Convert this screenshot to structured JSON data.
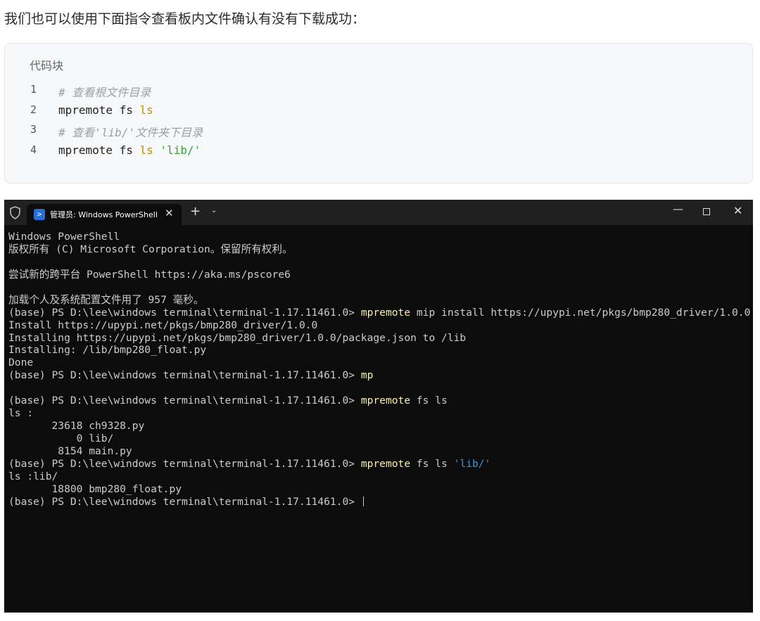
{
  "intro": "我们也可以使用下面指令查看板内文件确认有没有下载成功：",
  "code_block": {
    "title": "代码块",
    "lines": [
      {
        "n": "1",
        "comment": "# 查看根文件目录"
      },
      {
        "n": "2",
        "cmd": "mpremote fs ",
        "kw": "ls"
      },
      {
        "n": "3",
        "comment": "# 查看'lib/'文件夹下目录"
      },
      {
        "n": "4",
        "cmd": "mpremote fs ",
        "kw": "ls",
        "str": "'lib/'"
      }
    ]
  },
  "terminal": {
    "tab_title": "管理员: Windows PowerShell",
    "lines": [
      {
        "t": "Windows PowerShell"
      },
      {
        "t": "版权所有 (C) Microsoft Corporation。保留所有权利。"
      },
      {
        "t": ""
      },
      {
        "t": "尝试新的跨平台 PowerShell https://aka.ms/pscore6"
      },
      {
        "t": ""
      },
      {
        "t": "加载个人及系统配置文件用了 957 毫秒。"
      },
      {
        "t": "(base) PS D:\\lee\\windows terminal\\terminal-1.17.11461.0> ",
        "y": "mpremote",
        "r": " mip install https://upypi.net/pkgs/bmp280_driver/1.0.0"
      },
      {
        "t": "Install https://upypi.net/pkgs/bmp280_driver/1.0.0"
      },
      {
        "t": "Installing https://upypi.net/pkgs/bmp280_driver/1.0.0/package.json to /lib"
      },
      {
        "t": "Installing: /lib/bmp280_float.py"
      },
      {
        "t": "Done"
      },
      {
        "t": "(base) PS D:\\lee\\windows terminal\\terminal-1.17.11461.0> ",
        "y": "mp"
      },
      {
        "t": ""
      },
      {
        "t": "(base) PS D:\\lee\\windows terminal\\terminal-1.17.11461.0> ",
        "y": "mpremote",
        "r": " fs ls"
      },
      {
        "t": "ls :"
      },
      {
        "t": "       23618 ch9328.py"
      },
      {
        "t": "           0 lib/"
      },
      {
        "t": "        8154 main.py"
      },
      {
        "t": "(base) PS D:\\lee\\windows terminal\\terminal-1.17.11461.0> ",
        "y": "mpremote",
        "r": " fs ls ",
        "b": "'lib/'"
      },
      {
        "t": "ls :lib/"
      },
      {
        "t": "       18800 bmp280_float.py"
      },
      {
        "t": "(base) PS D:\\lee\\windows terminal\\terminal-1.17.11461.0> ",
        "cursor": true
      }
    ]
  }
}
